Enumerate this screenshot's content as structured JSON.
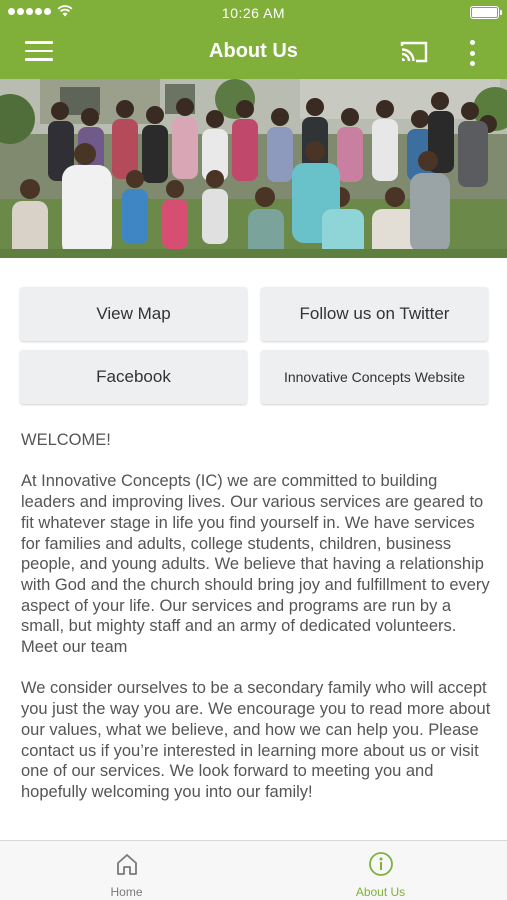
{
  "status_bar": {
    "time": "10:26 AM"
  },
  "header": {
    "title": "About Us"
  },
  "buttons": {
    "view_map": "View Map",
    "twitter": "Follow us on Twitter",
    "facebook": "Facebook",
    "website": "Innovative Concepts Website"
  },
  "content": {
    "greeting": "WELCOME!",
    "paragraph_1": "At Innovative Concepts (IC) we are committed to building leaders and improving lives. Our various services are geared to fit whatever stage in life you find yourself in. We have services for families and adults, college students, children, business people, and young adults. We believe that having a relationship with God and the church should bring joy and fulfillment to every aspect of your life. Our services and programs are run by a small, but mighty staff and an army of dedicated volunteers. Meet our team",
    "paragraph_2": "We consider ourselves to be a secondary family who will accept you just the way you are. We encourage you to read more about our values, what we believe, and how we can help you. Please contact us if you’re interested in learning more about us or visit one of our services. We look forward to meeting you and hopefully welcoming you into our family!"
  },
  "tabs": [
    {
      "label": "Home",
      "icon": "home-icon",
      "active": false
    },
    {
      "label": "About Us",
      "icon": "info-icon",
      "active": true
    }
  ],
  "colors": {
    "brand": "#80b03a",
    "button_bg": "#eeeff0",
    "tab_inactive": "#7a7a7a",
    "tab_active": "#80b03a"
  }
}
